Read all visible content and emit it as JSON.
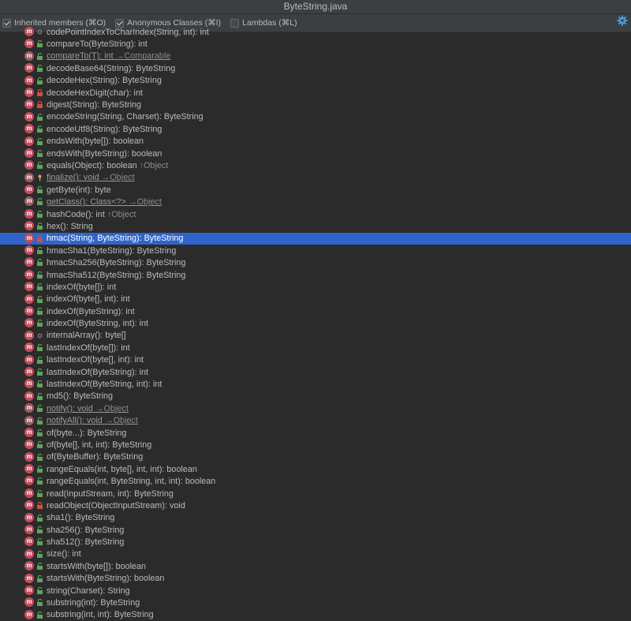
{
  "window": {
    "title": "ByteString.java"
  },
  "toolbar": {
    "inherited": {
      "label": "Inherited members (⌘O)",
      "checked": true
    },
    "anonymous": {
      "label": "Anonymous Classes (⌘I)",
      "checked": true
    },
    "lambdas": {
      "label": "Lambdas (⌘L)",
      "checked": false
    }
  },
  "icons": {
    "settings": "gear-icon",
    "method": "method-icon",
    "public": "unlock-icon",
    "private": "lock-icon",
    "package": "circle-icon",
    "protected": "key-icon"
  },
  "members": [
    {
      "sig": "codePointIndexToCharIndex(String, int): int",
      "origin": "",
      "vis": "package",
      "inherited": false
    },
    {
      "sig": "compareTo(ByteString): int",
      "origin": "",
      "vis": "public",
      "inherited": false
    },
    {
      "sig": "compareTo(T): int",
      "origin": "→Comparable",
      "vis": "public",
      "inherited": true
    },
    {
      "sig": "decodeBase64(String): ByteString",
      "origin": "",
      "vis": "public",
      "inherited": false
    },
    {
      "sig": "decodeHex(String): ByteString",
      "origin": "",
      "vis": "public",
      "inherited": false
    },
    {
      "sig": "decodeHexDigit(char): int",
      "origin": "",
      "vis": "private",
      "inherited": false
    },
    {
      "sig": "digest(String): ByteString",
      "origin": "",
      "vis": "private",
      "inherited": false
    },
    {
      "sig": "encodeString(String, Charset): ByteString",
      "origin": "",
      "vis": "public",
      "inherited": false
    },
    {
      "sig": "encodeUtf8(String): ByteString",
      "origin": "",
      "vis": "public",
      "inherited": false
    },
    {
      "sig": "endsWith(byte[]): boolean",
      "origin": "",
      "vis": "public",
      "inherited": false
    },
    {
      "sig": "endsWith(ByteString): boolean",
      "origin": "",
      "vis": "public",
      "inherited": false
    },
    {
      "sig": "equals(Object): boolean",
      "origin": "↑Object",
      "vis": "public",
      "inherited": false
    },
    {
      "sig": "finalize(): void",
      "origin": "→Object",
      "vis": "protected",
      "inherited": true
    },
    {
      "sig": "getByte(int): byte",
      "origin": "",
      "vis": "public",
      "inherited": false
    },
    {
      "sig": "getClass(): Class<?>",
      "origin": "→Object",
      "vis": "public",
      "inherited": true
    },
    {
      "sig": "hashCode(): int",
      "origin": "↑Object",
      "vis": "public",
      "inherited": false
    },
    {
      "sig": "hex(): String",
      "origin": "",
      "vis": "public",
      "inherited": false
    },
    {
      "sig": "hmac(String, ByteString): ByteString",
      "origin": "",
      "vis": "private",
      "inherited": false,
      "selected": true
    },
    {
      "sig": "hmacSha1(ByteString): ByteString",
      "origin": "",
      "vis": "public",
      "inherited": false
    },
    {
      "sig": "hmacSha256(ByteString): ByteString",
      "origin": "",
      "vis": "public",
      "inherited": false
    },
    {
      "sig": "hmacSha512(ByteString): ByteString",
      "origin": "",
      "vis": "public",
      "inherited": false
    },
    {
      "sig": "indexOf(byte[]): int",
      "origin": "",
      "vis": "public",
      "inherited": false
    },
    {
      "sig": "indexOf(byte[], int): int",
      "origin": "",
      "vis": "public",
      "inherited": false
    },
    {
      "sig": "indexOf(ByteString): int",
      "origin": "",
      "vis": "public",
      "inherited": false
    },
    {
      "sig": "indexOf(ByteString, int): int",
      "origin": "",
      "vis": "public",
      "inherited": false
    },
    {
      "sig": "internalArray(): byte[]",
      "origin": "",
      "vis": "package",
      "inherited": false
    },
    {
      "sig": "lastIndexOf(byte[]): int",
      "origin": "",
      "vis": "public",
      "inherited": false
    },
    {
      "sig": "lastIndexOf(byte[], int): int",
      "origin": "",
      "vis": "public",
      "inherited": false
    },
    {
      "sig": "lastIndexOf(ByteString): int",
      "origin": "",
      "vis": "public",
      "inherited": false
    },
    {
      "sig": "lastIndexOf(ByteString, int): int",
      "origin": "",
      "vis": "public",
      "inherited": false
    },
    {
      "sig": "md5(): ByteString",
      "origin": "",
      "vis": "public",
      "inherited": false
    },
    {
      "sig": "notify(): void",
      "origin": "→Object",
      "vis": "public",
      "inherited": true
    },
    {
      "sig": "notifyAll(): void",
      "origin": "→Object",
      "vis": "public",
      "inherited": true
    },
    {
      "sig": "of(byte...): ByteString",
      "origin": "",
      "vis": "public",
      "inherited": false
    },
    {
      "sig": "of(byte[], int, int): ByteString",
      "origin": "",
      "vis": "public",
      "inherited": false
    },
    {
      "sig": "of(ByteBuffer): ByteString",
      "origin": "",
      "vis": "public",
      "inherited": false
    },
    {
      "sig": "rangeEquals(int, byte[], int, int): boolean",
      "origin": "",
      "vis": "public",
      "inherited": false
    },
    {
      "sig": "rangeEquals(int, ByteString, int, int): boolean",
      "origin": "",
      "vis": "public",
      "inherited": false
    },
    {
      "sig": "read(InputStream, int): ByteString",
      "origin": "",
      "vis": "public",
      "inherited": false
    },
    {
      "sig": "readObject(ObjectInputStream): void",
      "origin": "",
      "vis": "private",
      "inherited": false
    },
    {
      "sig": "sha1(): ByteString",
      "origin": "",
      "vis": "public",
      "inherited": false
    },
    {
      "sig": "sha256(): ByteString",
      "origin": "",
      "vis": "public",
      "inherited": false
    },
    {
      "sig": "sha512(): ByteString",
      "origin": "",
      "vis": "public",
      "inherited": false
    },
    {
      "sig": "size(): int",
      "origin": "",
      "vis": "public",
      "inherited": false
    },
    {
      "sig": "startsWith(byte[]): boolean",
      "origin": "",
      "vis": "public",
      "inherited": false
    },
    {
      "sig": "startsWith(ByteString): boolean",
      "origin": "",
      "vis": "public",
      "inherited": false
    },
    {
      "sig": "string(Charset): String",
      "origin": "",
      "vis": "public",
      "inherited": false
    },
    {
      "sig": "substring(int): ByteString",
      "origin": "",
      "vis": "public",
      "inherited": false
    },
    {
      "sig": "substring(int, int): ByteString",
      "origin": "",
      "vis": "public",
      "inherited": false
    }
  ],
  "colors": {
    "selection": "#2f65ca",
    "method_icon": "#c24d5c",
    "public": "#5fa357",
    "private": "#d14f3c"
  }
}
